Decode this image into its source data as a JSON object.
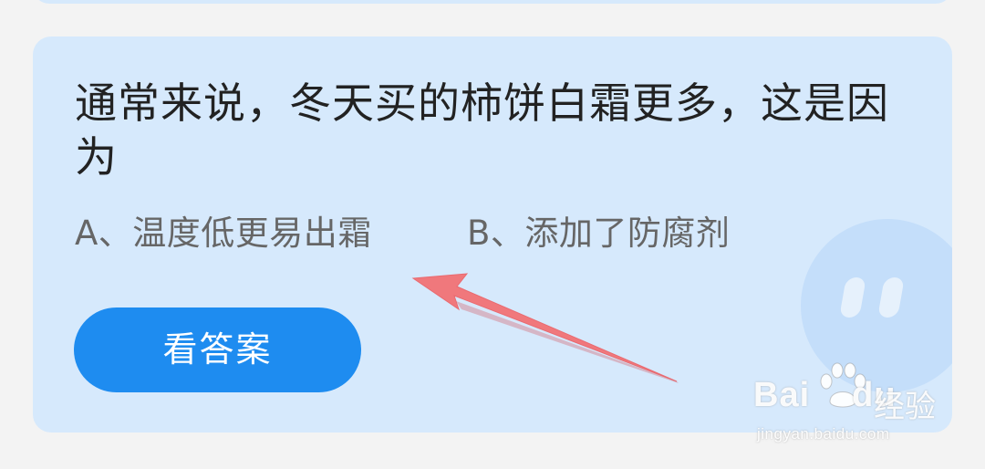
{
  "quiz": {
    "question": "通常来说，冬天买的柿饼白霜更多，这是因为",
    "options": [
      {
        "label": "A、温度低更易出霜"
      },
      {
        "label": "B、添加了防腐剂"
      }
    ],
    "answer_button_label": "看答案"
  },
  "watermark": {
    "brand": "Bai",
    "brand_suffix": "du",
    "product": "经验",
    "url": "jingyan.baidu.com"
  },
  "colors": {
    "card_background": "#d6e9fc",
    "button_background": "#1e8cf0",
    "arrow": "#f0787c",
    "page_background": "#f3f3f3"
  }
}
